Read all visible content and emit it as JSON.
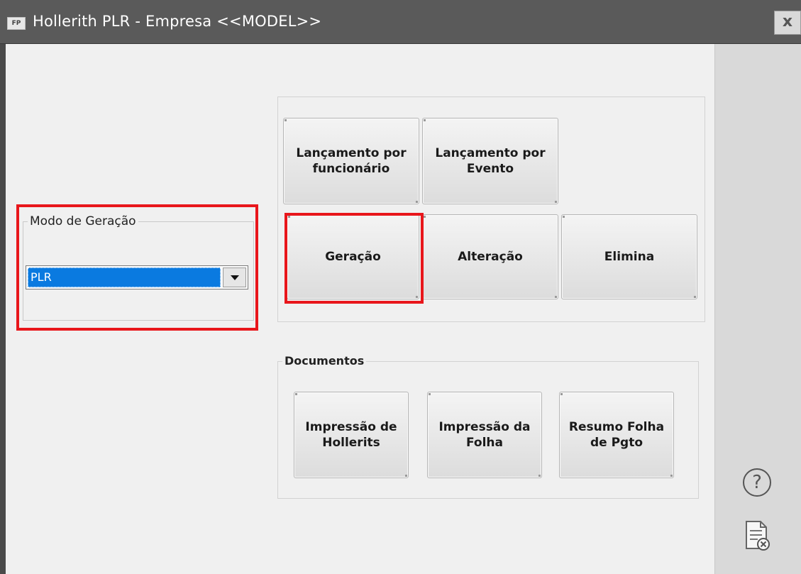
{
  "window": {
    "app_icon": "FP",
    "title": "Hollerith PLR - Empresa <<MODEL>>",
    "close_glyph": "x"
  },
  "modo_geracao": {
    "label": "Modo de Geração",
    "selected": "PLR"
  },
  "actions": {
    "lanc_funcionario": "Lançamento por\nfuncionário",
    "lanc_evento": "Lançamento por\nEvento",
    "geracao": "Geração",
    "alteracao": "Alteração",
    "elimina": "Elimina"
  },
  "documentos": {
    "label": "Documentos",
    "impressao_hollerits": "Impressão de\nHollerits",
    "impressao_folha": "Impressão da\nFolha",
    "resumo_folha": "Resumo Folha\nde Pgto"
  },
  "sidebar": {
    "help_glyph": "?",
    "help_icon": "help-circle-icon",
    "doc_icon": "document-cancel-icon"
  },
  "colors": {
    "highlight": "#e8161b",
    "selection": "#0a7ae0",
    "titlebar": "#5a5a5a"
  }
}
